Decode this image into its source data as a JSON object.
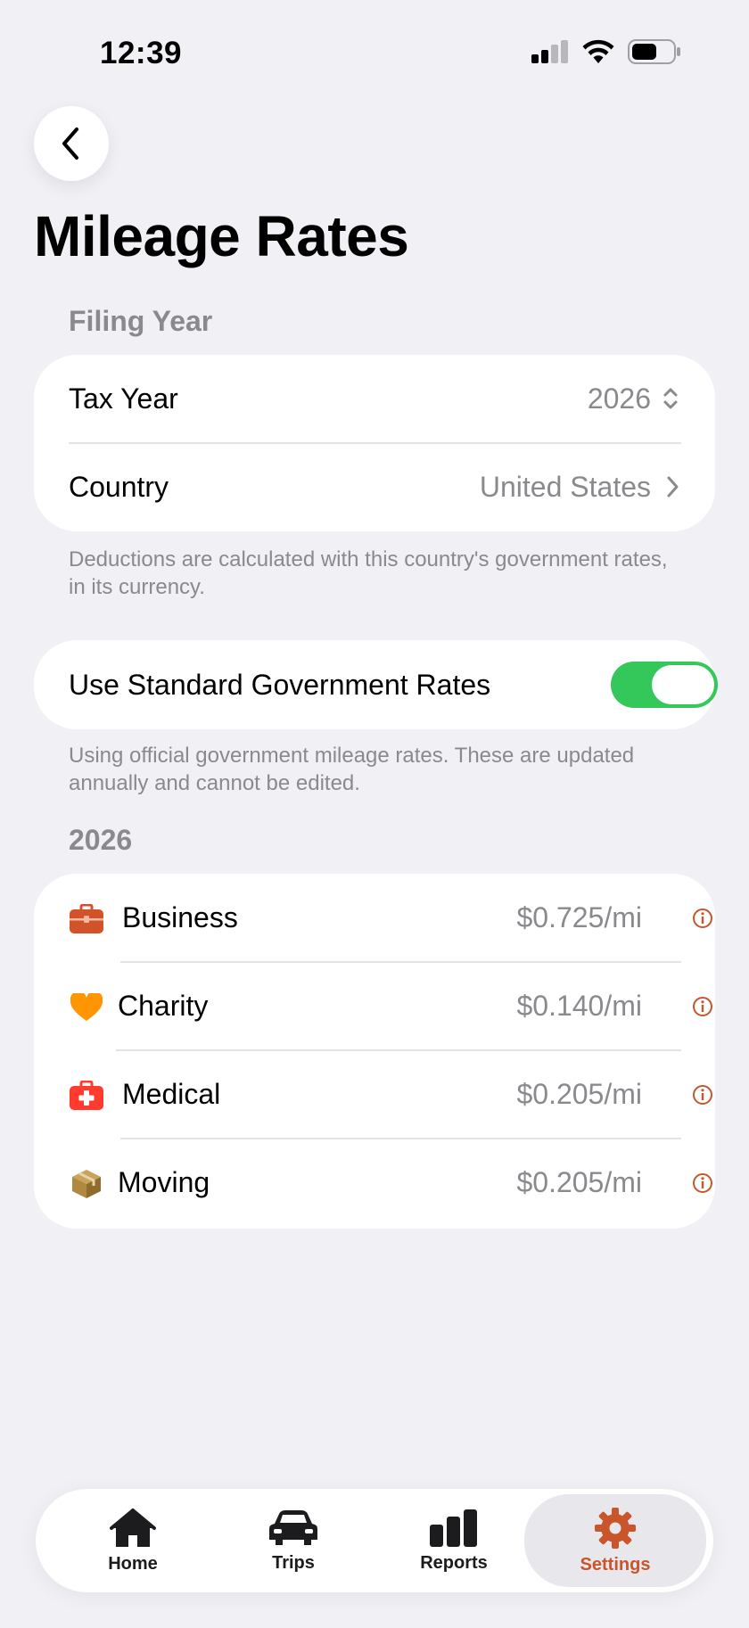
{
  "status_bar": {
    "time": "12:39"
  },
  "header": {
    "title": "Mileage Rates"
  },
  "filing": {
    "section_title": "Filing Year",
    "tax_year_label": "Tax Year",
    "tax_year_value": "2026",
    "country_label": "Country",
    "country_value": "United States",
    "footnote": "Deductions are calculated with this country's government rates, in its currency."
  },
  "standard_rates": {
    "label": "Use Standard Government Rates",
    "enabled": true,
    "footnote": "Using official government mileage rates. These are updated annually and cannot be edited."
  },
  "rates": {
    "section_title": "2026",
    "items": [
      {
        "label": "Business",
        "value": "$0.725/mi",
        "icon": "briefcase-icon",
        "color": "#d2532a"
      },
      {
        "label": "Charity",
        "value": "$0.140/mi",
        "icon": "heart-icon",
        "color": "#ff9500"
      },
      {
        "label": "Medical",
        "value": "$0.205/mi",
        "icon": "medical-kit-icon",
        "color": "#ff3b30"
      },
      {
        "label": "Moving",
        "value": "$0.205/mi",
        "icon": "box-icon",
        "color": "#b08840"
      }
    ]
  },
  "tab_bar": {
    "tabs": [
      {
        "label": "Home",
        "icon": "house-icon"
      },
      {
        "label": "Trips",
        "icon": "car-icon"
      },
      {
        "label": "Reports",
        "icon": "bar-chart-icon"
      },
      {
        "label": "Settings",
        "icon": "gear-icon",
        "active": true
      }
    ]
  },
  "colors": {
    "accent": "#c8552b",
    "toggle_on": "#34c759",
    "background": "#f0f0f5"
  }
}
